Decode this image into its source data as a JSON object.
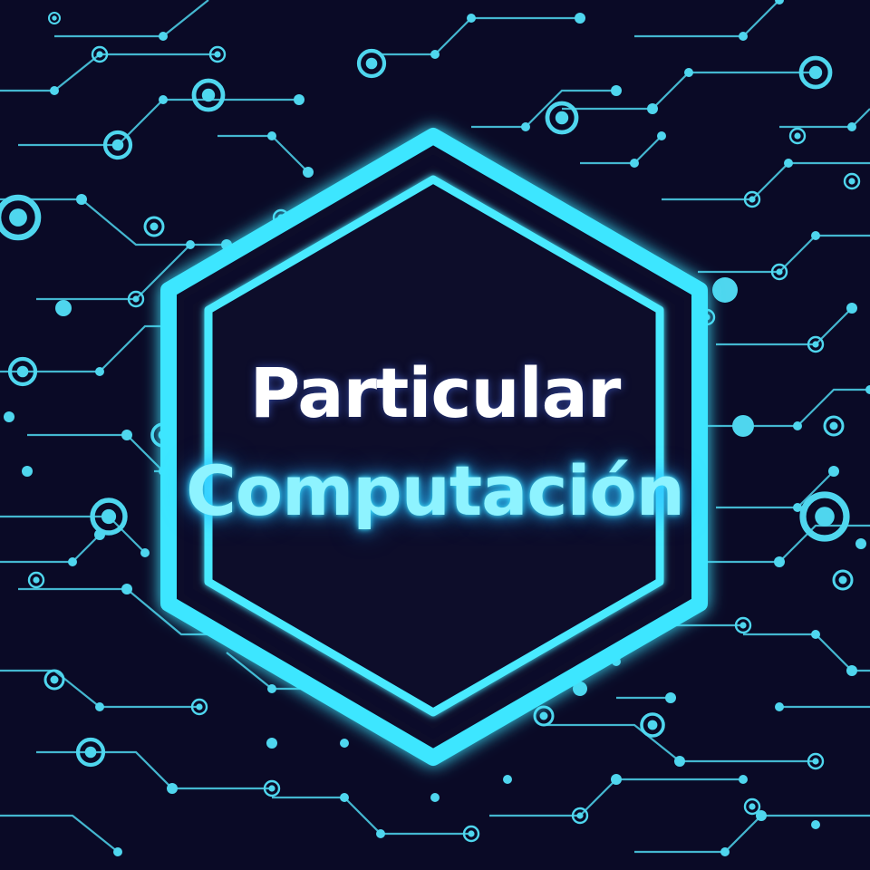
{
  "title": {
    "line1": "Particular",
    "line2": "Computación"
  },
  "colors": {
    "background": "#0a0a26",
    "circuit": "#4fd6ee",
    "hexagon_glow": "#3ee6ff",
    "hexagon_fill": "#0b0b2a",
    "text_primary": "#ffffff",
    "text_accent": "#8ef3ff"
  },
  "icons": [
    "circuit-board-pattern",
    "hexagon-frame"
  ]
}
